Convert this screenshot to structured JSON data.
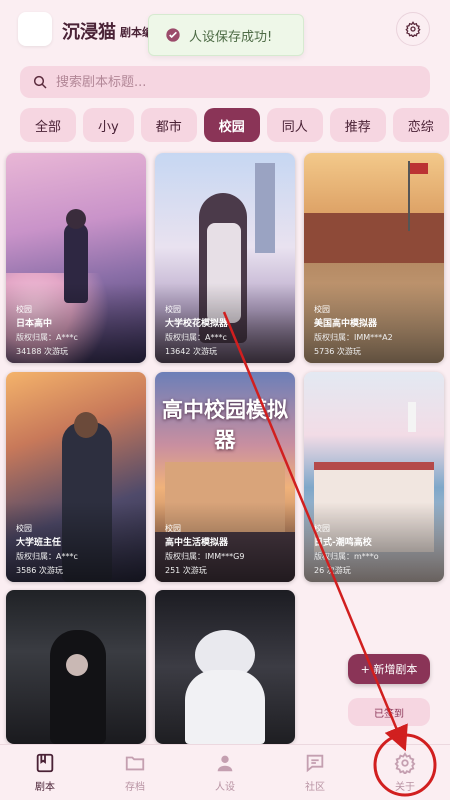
{
  "header": {
    "app_name": "沉浸猫",
    "subtitle": "剧本编",
    "settings_icon": "gear-icon"
  },
  "toast": {
    "icon": "check-circle-icon",
    "message": "人设保存成功!"
  },
  "search": {
    "placeholder": "搜索剧本标题..."
  },
  "tabs": [
    {
      "label": "全部",
      "active": false
    },
    {
      "label": "小y",
      "active": false
    },
    {
      "label": "都市",
      "active": false
    },
    {
      "label": "校园",
      "active": true
    },
    {
      "label": "同人",
      "active": false
    },
    {
      "label": "推荐",
      "active": false
    },
    {
      "label": "恋综",
      "active": false
    }
  ],
  "cards": [
    {
      "tag": "校园",
      "name": "日本高中",
      "owner": "版权归属：A***c",
      "plays": "34188 次游玩"
    },
    {
      "tag": "校园",
      "name": "大学校花模拟器",
      "owner": "版权归属：A***c",
      "plays": "13642 次游玩"
    },
    {
      "tag": "校园",
      "name": "美国高中模拟器",
      "owner": "版权归属：IMM***A2",
      "plays": "5736 次游玩"
    },
    {
      "tag": "校园",
      "name": "大学班主任",
      "owner": "版权归属：A***c",
      "plays": "3586 次游玩"
    },
    {
      "tag": "校园",
      "name": "高中生活模拟器",
      "owner": "版权归属：IMM***G9",
      "plays": "251 次游玩",
      "cover_title": "高中校园模拟器"
    },
    {
      "tag": "校园",
      "name": "日式-潮鸣高校",
      "owner": "版权归属：m***o",
      "plays": "26 次游玩"
    },
    {
      "tag": "",
      "name": "",
      "owner": "",
      "plays": ""
    },
    {
      "tag": "",
      "name": "",
      "owner": "",
      "plays": ""
    }
  ],
  "actions": {
    "add_label": "+ 新增剧本",
    "checkin_label": "已签到"
  },
  "bottom_nav": [
    {
      "label": "剧本",
      "icon": "book-icon",
      "active": true
    },
    {
      "label": "存档",
      "icon": "folder-icon",
      "active": false
    },
    {
      "label": "人设",
      "icon": "person-icon",
      "active": false
    },
    {
      "label": "社区",
      "icon": "chat-icon",
      "active": false
    },
    {
      "label": "关于",
      "icon": "gear-icon",
      "active": false
    }
  ],
  "colors": {
    "accent": "#8a3457",
    "annotation": "#d11f1f"
  }
}
